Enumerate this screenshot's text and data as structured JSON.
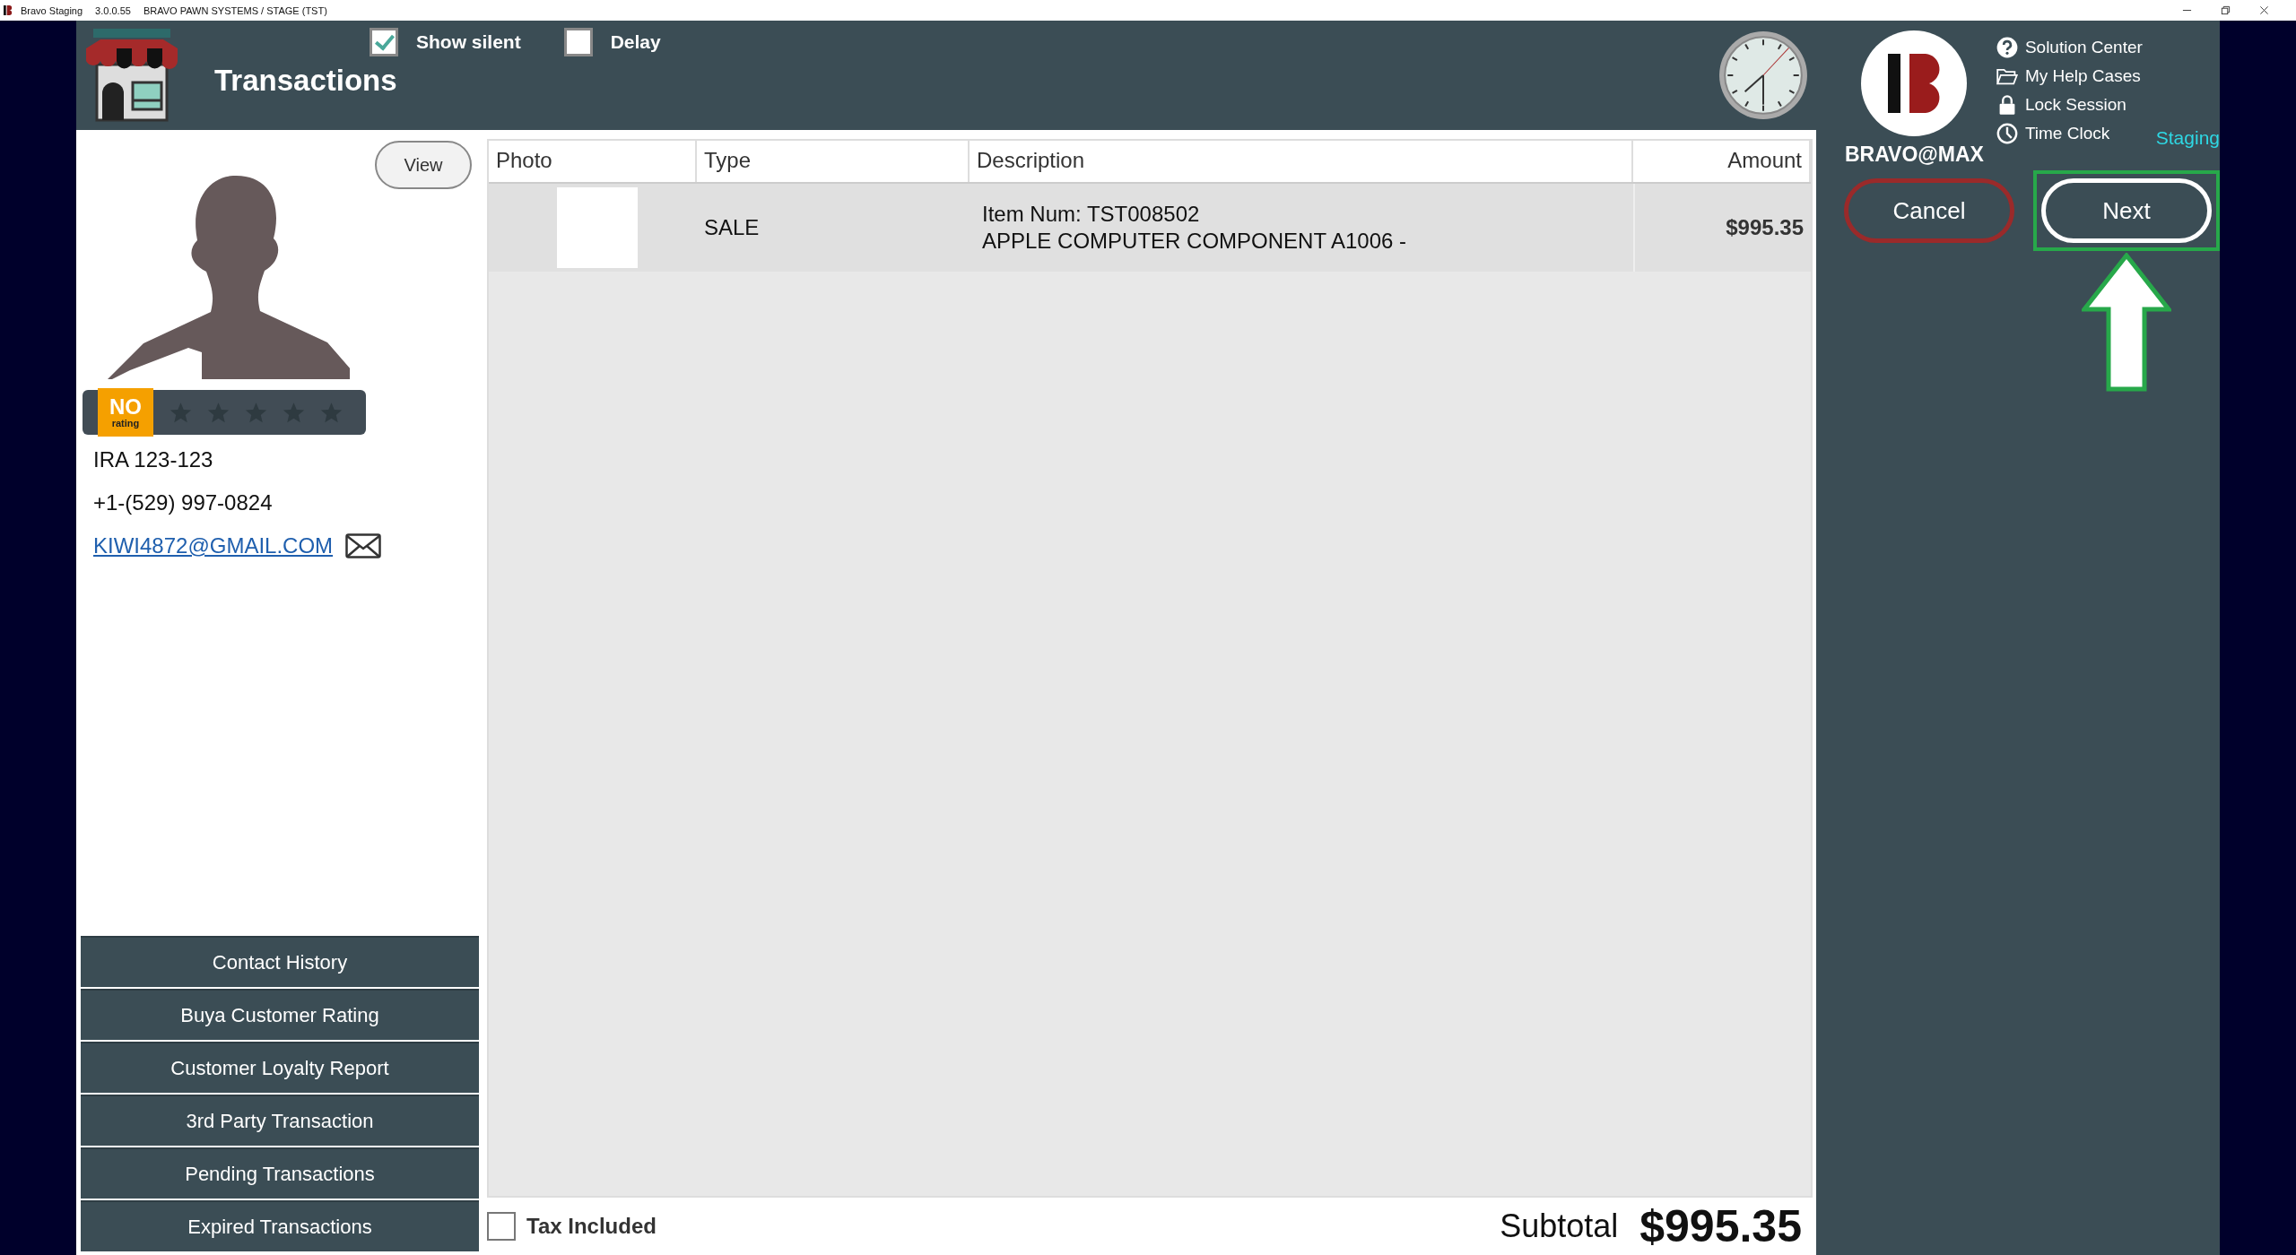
{
  "title_bar": {
    "app_name": "Bravo Staging",
    "version": "3.0.0.55",
    "environment": "BRAVO PAWN SYSTEMS / STAGE (TST)"
  },
  "header": {
    "title": "Transactions",
    "options": [
      {
        "label": "Show silent",
        "checked": true
      },
      {
        "label": "Delay",
        "checked": false
      }
    ]
  },
  "customer": {
    "view_button": "View",
    "rating_badge": {
      "top": "NO",
      "bottom": "rating"
    },
    "stars": 0,
    "name": "IRA 123-123",
    "phone": "+1-(529) 997-0824",
    "email": "KIWI4872@GMAIL.COM"
  },
  "customer_actions": [
    "Contact History",
    "Buya Customer Rating",
    "Customer Loyalty Report",
    "3rd Party Transaction",
    "Pending Transactions",
    "Expired Transactions"
  ],
  "table": {
    "columns": [
      "Photo",
      "Type",
      "Description",
      "Amount"
    ],
    "rows": [
      {
        "type": "SALE",
        "description": [
          "Item Num: TST008502",
          "APPLE COMPUTER COMPONENT A1006 -"
        ],
        "amount": "$995.35"
      }
    ]
  },
  "footer": {
    "tax_included": {
      "label": "Tax Included",
      "checked": false
    },
    "subtotal_label": "Subtotal",
    "subtotal": "$995.35"
  },
  "brand": {
    "name": "BRAVO@MAX"
  },
  "help_links": [
    {
      "label": "Solution Center",
      "kind": "question"
    },
    {
      "label": "My Help Cases",
      "kind": "folder"
    },
    {
      "label": "Lock Session",
      "kind": "lock"
    },
    {
      "label": "Time Clock",
      "kind": "clock"
    }
  ],
  "environment_badge": "Staging",
  "actions": [
    {
      "label": "Cancel",
      "kind": "cancel",
      "highlighted": false
    },
    {
      "label": "Next",
      "kind": "next",
      "highlighted": true
    }
  ]
}
